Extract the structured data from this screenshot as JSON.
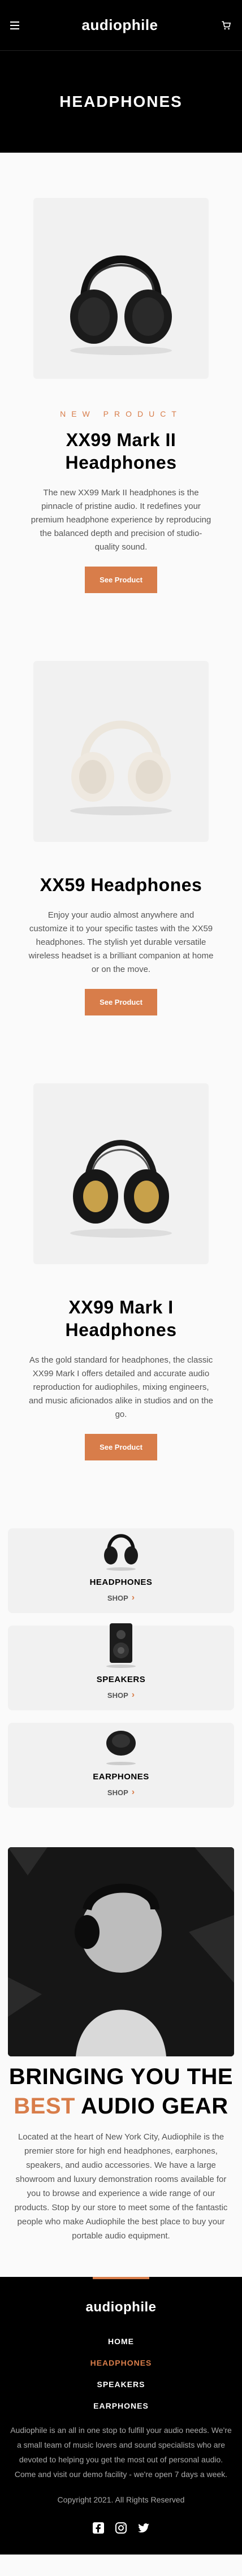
{
  "header": {
    "logo": "audiophile",
    "icons": [
      "hamburger-icon",
      "cart-icon"
    ]
  },
  "hero": {
    "title": "HEADPHONES"
  },
  "products": [
    {
      "overline": "NEW PRODUCT",
      "name": "XX99 Mark II Headphones",
      "description": "The new XX99 Mark II headphones is the pinnacle of pristine audio. It redefines your premium headphone experience by reproducing the balanced depth and precision of studio-quality sound.",
      "button": "See Product"
    },
    {
      "name": "XX59 Headphones",
      "description": "Enjoy your audio almost anywhere and customize it to your specific tastes with the XX59 headphones. The stylish yet durable versatile wireless headset is a brilliant companion at home or on the move.",
      "button": "See Product"
    },
    {
      "name": "XX99 Mark I Headphones",
      "description": "As the gold standard for headphones, the classic XX99 Mark I offers detailed and accurate audio reproduction for audiophiles, mixing engineers, and music aficionados alike in studios and on the go.",
      "button": "See Product"
    }
  ],
  "categories": [
    {
      "title": "HEADPHONES",
      "shop": "SHOP"
    },
    {
      "title": "SPEAKERS",
      "shop": "SHOP"
    },
    {
      "title": "EARPHONES",
      "shop": "SHOP"
    }
  ],
  "about": {
    "title_line1": "BRINGING YOU THE",
    "title_accent": "BEST",
    "title_rest": "AUDIO GEAR",
    "body": "Located at the heart of New York City, Audiophile is the premier store for high end headphones, earphones, speakers, and audio accessories. We have a large showroom and luxury demonstration rooms available for you to browse and experience a wide range of our products. Stop by our store to meet some of the fantastic people who make Audiophile the best place to buy your portable audio equipment."
  },
  "footer": {
    "logo": "audiophile",
    "nav": [
      "HOME",
      "HEADPHONES",
      "SPEAKERS",
      "EARPHONES"
    ],
    "description": "Audiophile is an all in one stop to fulfill your audio needs. We're a small team of music lovers and sound specialists who are devoted to helping you get the most out of personal audio. Come and visit our demo facility - we're open 7 days a week.",
    "copyright": "Copyright 2021. All Rights Reserved",
    "social": [
      "facebook-icon",
      "instagram-icon",
      "twitter-icon"
    ]
  },
  "colors": {
    "accent": "#d87d4a",
    "dark": "#000000",
    "light_bg": "#f1f1f1"
  }
}
